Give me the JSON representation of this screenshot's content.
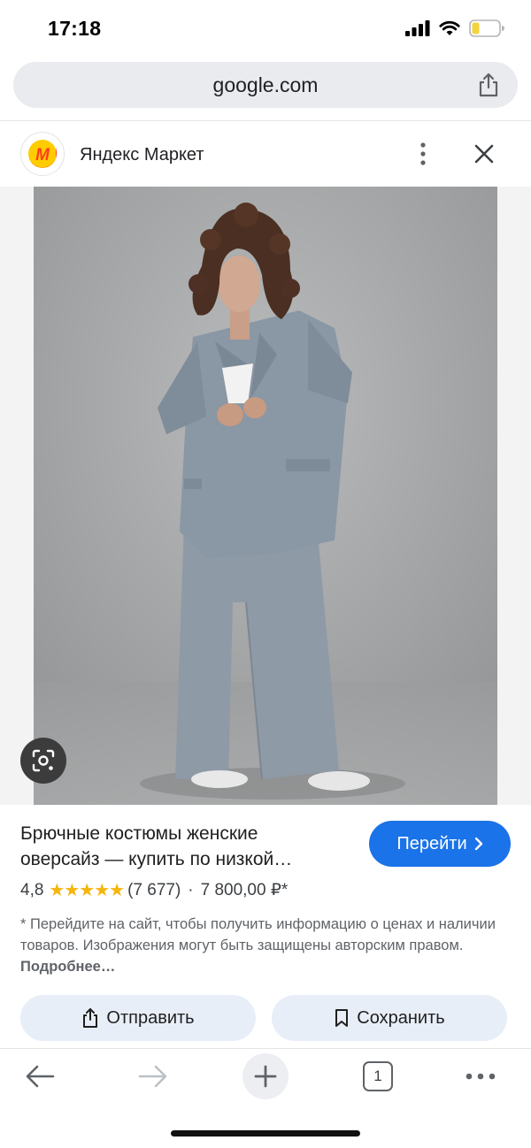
{
  "status_bar": {
    "time": "17:18",
    "icons": [
      "cellular-signal-icon",
      "wifi-icon",
      "battery-icon"
    ],
    "battery_color": "#f5d33b"
  },
  "browser": {
    "url": "google.com",
    "share_icon": "share-icon"
  },
  "source": {
    "name": "Яндекс Маркет",
    "logo_letter": "M",
    "logo_colors": {
      "outer": "#ffcc00",
      "inner": "#fc3f1d"
    },
    "more_icon": "more-vert-icon",
    "close_icon": "close-icon"
  },
  "image": {
    "lens_icon": "lens-search-icon"
  },
  "result": {
    "title_line1": "Брючные костюмы женские",
    "title_line2": "оверсайз — купить по низкой…",
    "go_label": "Перейти",
    "rating": "4,8",
    "stars": "★★★★★",
    "reviews": "(7 677)",
    "separator": "·",
    "price": "7 800,00 ₽*",
    "disclaimer": "* Перейдите на сайт, чтобы получить информацию о ценах и наличии товаров. Изображения могут быть защищены авторским правом.",
    "more_link": "Подробнее…",
    "accent_color": "#1a73e8"
  },
  "actions": {
    "send_label": "Отправить",
    "save_label": "Сохранить"
  },
  "toolbar": {
    "tab_count": "1",
    "icons": [
      "back-arrow-icon",
      "forward-arrow-icon",
      "plus-icon",
      "tabs-icon",
      "more-horiz-icon"
    ]
  }
}
